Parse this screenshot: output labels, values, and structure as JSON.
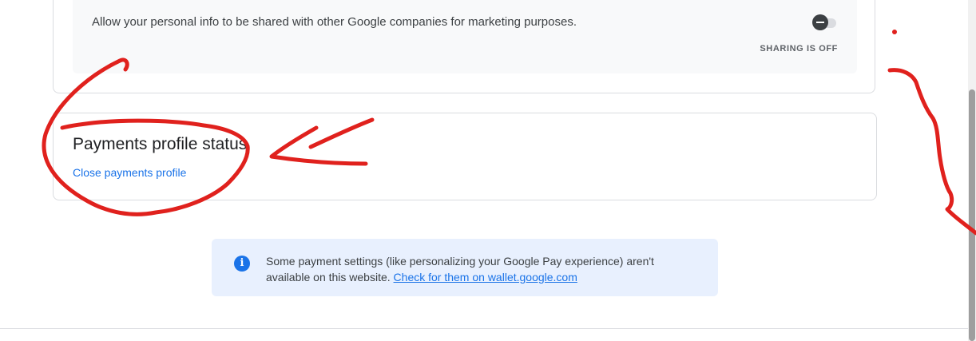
{
  "sharing": {
    "description": "Allow your personal info to be shared with other Google companies for marketing purposes.",
    "status": "SHARING IS OFF",
    "toggle_on": false
  },
  "payments_status": {
    "title": "Payments profile status",
    "close_link": "Close payments profile"
  },
  "info_banner": {
    "text": "Some payment settings (like personalizing your Google Pay experience) aren't available on this website. ",
    "link": "Check for them on wallet.google.com"
  },
  "colors": {
    "accent": "#1a73e8",
    "banner_bg": "#e8f0fe",
    "annotation": "#e0211d"
  }
}
